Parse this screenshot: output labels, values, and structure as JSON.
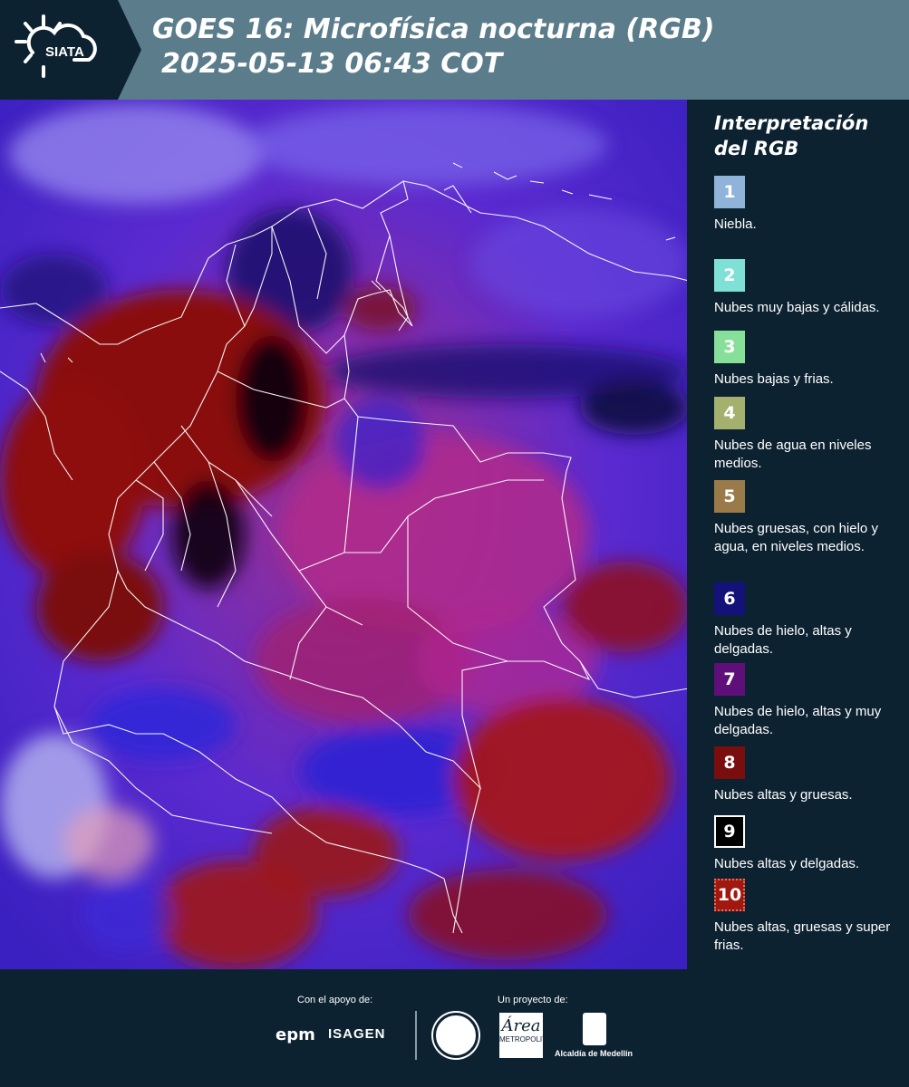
{
  "header": {
    "logo_text": "SIATA",
    "title_line1": "GOES 16: Microfísica nocturna (RGB)",
    "title_line2": "2025-05-13 06:43 COT"
  },
  "legend": {
    "title": "Interpretación del RGB",
    "items": [
      {
        "number": "1",
        "color": "#8fb3d9",
        "label": "Niebla."
      },
      {
        "number": "2",
        "color": "#7fe0d8",
        "label": "Nubes muy bajas y cálidas."
      },
      {
        "number": "3",
        "color": "#86e09a",
        "label": "Nubes bajas y frias."
      },
      {
        "number": "4",
        "color": "#a3b06e",
        "label": "Nubes de agua en niveles medios."
      },
      {
        "number": "5",
        "color": "#9a7a48",
        "label": "Nubes gruesas, con hielo y agua, en niveles medios."
      },
      {
        "number": "6",
        "color": "#12127a",
        "label": "Nubes de hielo, altas y delgadas."
      },
      {
        "number": "7",
        "color": "#5e0f7a",
        "label": "Nubes de hielo, altas y muy delgadas."
      },
      {
        "number": "8",
        "color": "#7a0d0d",
        "label": "Nubes altas y gruesas."
      },
      {
        "number": "9",
        "color": "#000000",
        "label": "Nubes altas y delgadas."
      },
      {
        "number": "10",
        "color": "#a0180e",
        "label": "Nubes altas, gruesas y super frias."
      }
    ]
  },
  "footer": {
    "support_label": "Con el apoyo de:",
    "project_label": "Un proyecto de:",
    "sponsor1": "epm",
    "sponsor2": "ISAGEN",
    "area_logo_big": "Área",
    "area_logo_small": "METROPOLITANA",
    "alcaldia": "Alcaldía de Medellín"
  }
}
